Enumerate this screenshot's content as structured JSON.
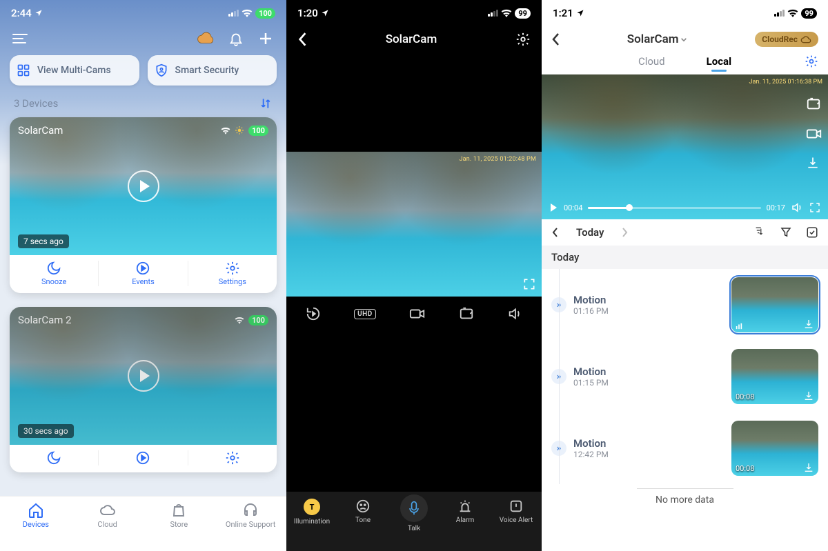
{
  "pane1": {
    "status": {
      "time": "2:44",
      "battery": "100"
    },
    "pills": {
      "multi": "View Multi-Cams",
      "smart": "Smart Security"
    },
    "devices_label": "3 Devices",
    "cards": [
      {
        "name": "SolarCam",
        "battery": "100",
        "ago": "7 secs ago"
      },
      {
        "name": "SolarCam 2",
        "battery": "100",
        "ago": "30 secs ago"
      }
    ],
    "actions": {
      "snooze": "Snooze",
      "events": "Events",
      "settings": "Settings"
    },
    "bottom": {
      "devices": "Devices",
      "cloud": "Cloud",
      "store": "Store",
      "support": "Online Support"
    }
  },
  "pane2": {
    "status": {
      "time": "1:20",
      "battery": "99"
    },
    "title": "SolarCam",
    "video_ts": "Jan. 11, 2025 01:20:48 PM",
    "toolbar": {
      "uhd": "UHD"
    },
    "bottom": {
      "illum": "Illumination",
      "tone": "Tone",
      "talk": "Talk",
      "alarm": "Alarm",
      "voice": "Voice Alert"
    }
  },
  "pane3": {
    "status": {
      "time": "1:21",
      "battery": "99"
    },
    "title": "SolarCam",
    "cloudrec": "CloudRec",
    "tabs": {
      "cloud": "Cloud",
      "local": "Local"
    },
    "player_ts": "Jan. 11, 2025 01:16:38 PM",
    "scrub": {
      "cur": "00:04",
      "dur": "00:17"
    },
    "date_label": "Today",
    "section": "Today",
    "events": [
      {
        "title": "Motion",
        "time": "01:16 PM",
        "dur": "",
        "selected": true
      },
      {
        "title": "Motion",
        "time": "01:15 PM",
        "dur": "00:08",
        "selected": false
      },
      {
        "title": "Motion",
        "time": "12:42 PM",
        "dur": "00:08",
        "selected": false
      }
    ],
    "no_more": "No more data"
  }
}
